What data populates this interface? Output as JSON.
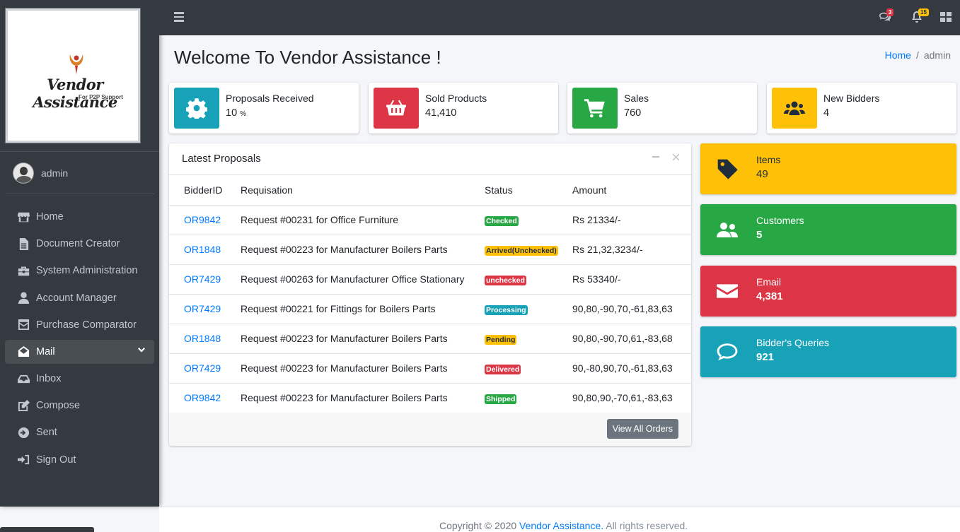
{
  "brand": {
    "title": "Vendor Assistance",
    "subtitle": "For P2P Support"
  },
  "user": {
    "name": "admin"
  },
  "nav": [
    {
      "label": "Home",
      "icon": "store-icon"
    },
    {
      "label": "Document Creator",
      "icon": "file-icon"
    },
    {
      "label": "System Administration",
      "icon": "toolbox-icon"
    },
    {
      "label": "Account Manager",
      "icon": "user-icon"
    },
    {
      "label": "Purchase Comparator",
      "icon": "envelope-square-icon"
    },
    {
      "label": "Mail",
      "icon": "envelope-open-icon",
      "active": true
    },
    {
      "label": "Inbox",
      "icon": "inbox-icon"
    },
    {
      "label": "Compose",
      "icon": "edit-icon"
    },
    {
      "label": "Sent",
      "icon": "arrow-circle-right-icon"
    },
    {
      "label": "Sign Out",
      "icon": "sign-out-icon"
    }
  ],
  "topbar": {
    "messages_count": "3",
    "notifications_count": "15"
  },
  "header": {
    "title": "Welcome To Vendor Assistance !",
    "breadcrumb_home": "Home",
    "breadcrumb_current": "admin"
  },
  "info_boxes": [
    {
      "label": "Proposals Received",
      "value": "10",
      "unit": "%",
      "color": "#17a2b8",
      "icon": "cog-icon"
    },
    {
      "label": "Sold Products",
      "value": "41,410",
      "color": "#dc3545",
      "icon": "shopping-basket-icon"
    },
    {
      "label": "Sales",
      "value": "760",
      "color": "#28a745",
      "icon": "shopping-cart-icon"
    },
    {
      "label": "New Bidders",
      "value": "4",
      "color": "#ffc107",
      "icon": "users-icon"
    }
  ],
  "proposals": {
    "title": "Latest Proposals",
    "columns": [
      "BidderID",
      "Requisation",
      "Status",
      "Amount"
    ],
    "rows": [
      {
        "id": "OR9842",
        "req": "Request #00231 for Office Furniture",
        "status": "Checked",
        "status_type": "success",
        "amount": "Rs 21334/-"
      },
      {
        "id": "OR1848",
        "req": "Request #00223 for Manufacturer Boilers Parts",
        "status": "Arrived(Unchecked)",
        "status_type": "warning",
        "amount": "Rs 21,32,3234/-"
      },
      {
        "id": "OR7429",
        "req": "Request #00263 for Manufacturer Office Stationary",
        "status": "unchecked",
        "status_type": "danger",
        "amount": "Rs 53340/-"
      },
      {
        "id": "OR7429",
        "req": "Request #00221 for Fittings for Boilers Parts",
        "status": "Processing",
        "status_type": "info",
        "amount": "90,80,-90,70,-61,83,63"
      },
      {
        "id": "OR1848",
        "req": "Request #00223 for Manufacturer Boilers Parts",
        "status": "Pending",
        "status_type": "warning",
        "amount": "90,80,-90,70,61,-83,68"
      },
      {
        "id": "OR7429",
        "req": "Request #00223 for Manufacturer Boilers Parts",
        "status": "Delivered",
        "status_type": "danger",
        "amount": "90,-80,90,70,-61,83,63"
      },
      {
        "id": "OR9842",
        "req": "Request #00223 for Manufacturer Boilers Parts",
        "status": "Shipped",
        "status_type": "success",
        "amount": "90,80,90,-70,61,-83,63"
      }
    ],
    "view_all_label": "View All Orders"
  },
  "small_boxes": [
    {
      "label": "Items",
      "value": "49",
      "color": "#ffc107",
      "icon": "tag-icon"
    },
    {
      "label": "Customers",
      "value": "5",
      "color": "#28a745",
      "icon": "user-friends-icon"
    },
    {
      "label": "Email",
      "value": "4,381",
      "color": "#dc3545",
      "icon": "envelope-icon"
    },
    {
      "label": "Bidder's Queries",
      "value": "921",
      "color": "#17a2b8",
      "icon": "comment-icon"
    }
  ],
  "footer": {
    "prefix": "Copyright © 2020",
    "link": "Vendor Assistance.",
    "suffix": "All rights reserved."
  }
}
